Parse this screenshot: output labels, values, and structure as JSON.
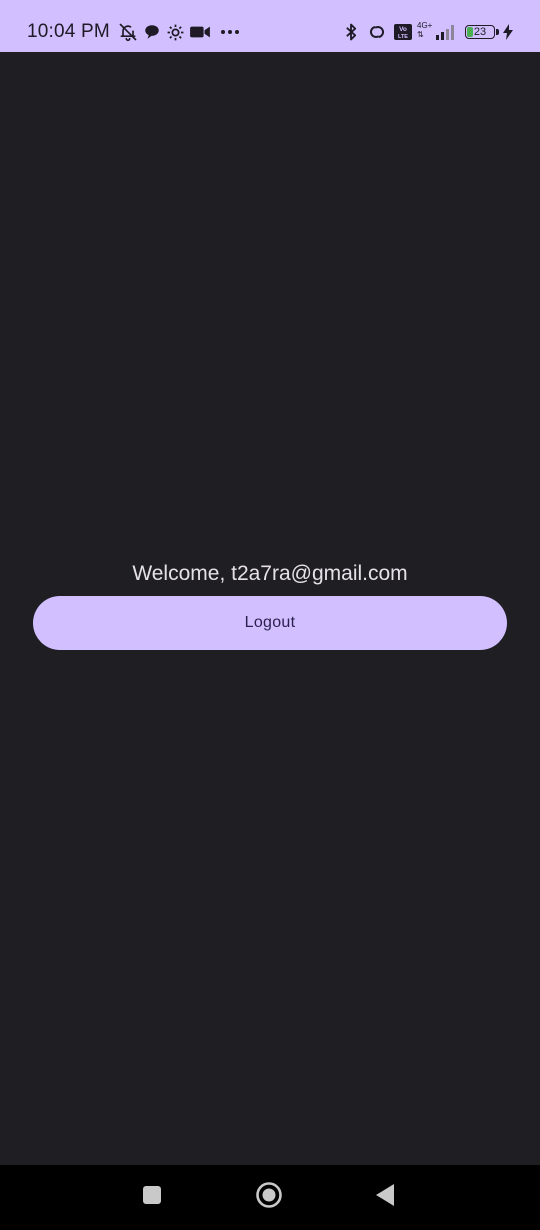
{
  "colors": {
    "accent": "#d1bfff",
    "background": "#1f1e23",
    "on_accent": "#2a1f4d",
    "text": "#e6e1e9",
    "nav_bar": "#000000",
    "battery_fill": "#4caf50"
  },
  "status_bar": {
    "time": "10:04 PM",
    "left_icons": [
      "bell-off-icon",
      "chat-bubble-icon",
      "settings-gear-icon",
      "video-camera-icon",
      "more-dots-icon"
    ],
    "right_icons": [
      "bluetooth-icon",
      "hotspot-link-icon",
      "volte-icon",
      "signal-strength-icon",
      "battery-icon",
      "charging-bolt-icon"
    ],
    "volte_label": "Vo LTE",
    "network_label": "4G+",
    "battery_level": "23",
    "battery_fraction": 0.23
  },
  "main": {
    "welcome_text": "Welcome, t2a7ra@gmail.com",
    "logout_label": "Logout"
  },
  "navigation_bar": {
    "buttons": [
      "recents-square-icon",
      "home-circle-icon",
      "back-triangle-icon"
    ]
  }
}
